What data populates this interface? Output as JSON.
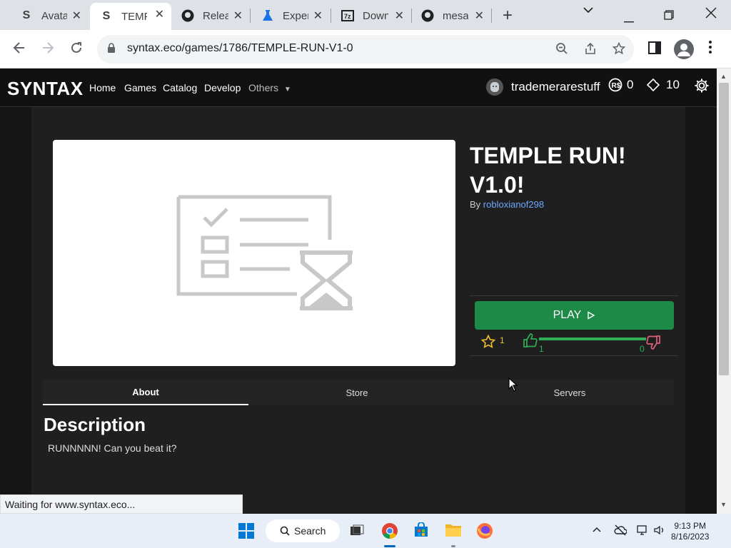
{
  "browser": {
    "tabs": [
      {
        "title": "Avatar",
        "icon": "syntax-logo-icon"
      },
      {
        "title": "TEMPLE",
        "icon": "syntax-logo-icon",
        "active": true
      },
      {
        "title": "Releases",
        "icon": "github-icon"
      },
      {
        "title": "Experiments",
        "icon": "flask-icon"
      },
      {
        "title": "Download",
        "icon": "7zip-icon"
      },
      {
        "title": "mesa",
        "icon": "github-icon"
      }
    ],
    "url": "syntax.eco/games/1786/TEMPLE-RUN-V1-0",
    "status_text": "Waiting for www.syntax.eco..."
  },
  "site": {
    "logo": "SYNTAX",
    "nav": [
      "Home",
      "Games",
      "Catalog",
      "Develop",
      "Others"
    ],
    "username": "trademerarestuff",
    "robux": "0",
    "tix": "10"
  },
  "game": {
    "title": "TEMPLE RUN! V1.0!",
    "by_label": "By",
    "creator": "robloxianof298",
    "play_label": "PLAY",
    "favorites": "1",
    "upvotes": "1",
    "downvotes": "0",
    "like_ratio": 1.0
  },
  "tabs": [
    "About",
    "Store",
    "Servers"
  ],
  "description": {
    "heading": "Description",
    "text": "RUNNNNN! Can you beat it?"
  },
  "taskbar": {
    "search_label": "Search",
    "time": "9:13 PM",
    "date": "8/16/2023"
  }
}
